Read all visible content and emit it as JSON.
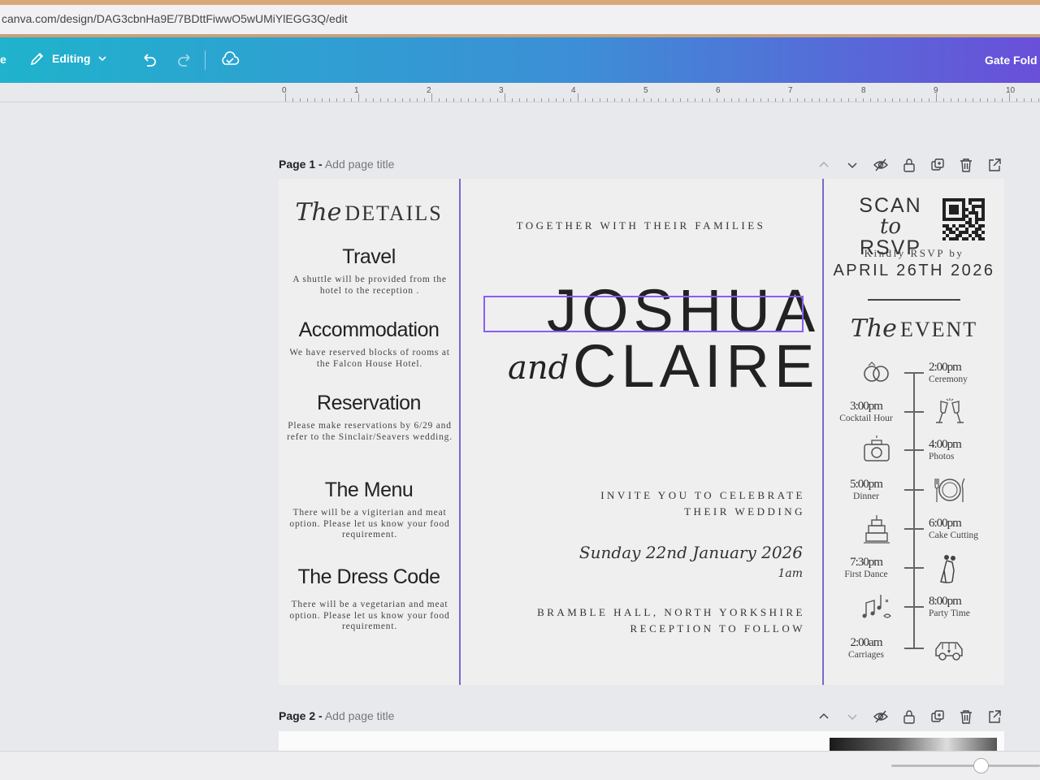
{
  "browser": {
    "url": "canva.com/design/DAG3cbnHa9E/7BDttFiwwO5wUMiYlEGG3Q/edit"
  },
  "toolbar": {
    "left_partial": "e",
    "editing_label": "Editing",
    "doc_title": "Gate Fold",
    "icons": [
      "pencil-icon",
      "chevron-down-icon",
      "undo-icon",
      "redo-icon",
      "cloud-sync-icon"
    ]
  },
  "ruler": {
    "ticks": [
      "0",
      "1",
      "2",
      "3",
      "4",
      "5",
      "6",
      "7",
      "8",
      "9",
      "10"
    ]
  },
  "page1": {
    "label": "Page 1 -",
    "title_placeholder": "Add page title"
  },
  "page2": {
    "label": "Page 2 -",
    "title_placeholder": "Add page title"
  },
  "details": {
    "title_script": "The",
    "title": "DETAILS",
    "sections": [
      {
        "heading": "Travel",
        "body": "A shuttle will be provided from the hotel to the reception ."
      },
      {
        "heading": "Accommodation",
        "body": "We have reserved blocks of rooms at the Falcon House Hotel."
      },
      {
        "heading": "Reservation",
        "body": "Please make reservations by 6/29 and refer to the Sinclair/Seavers wedding."
      },
      {
        "heading": "The Menu",
        "body": "There will be a vigiterian and meat option.  Please let us know your food requirement."
      },
      {
        "heading": "The Dress Code",
        "body": "There will be a vegetarian and meat option.  Please let us know your food requirement."
      }
    ]
  },
  "invite": {
    "together": "TOGETHER WITH THEIR FAMILIES",
    "name1": "JOSHUA",
    "and": "and",
    "name2": "CLAIRE",
    "invite_line1": "INVITE YOU TO CELEBRATE",
    "invite_line2": "THEIR WEDDING",
    "date": "Sunday 22nd January 2026",
    "time": "1am",
    "venue_line1": "BRAMBLE HALL, NORTH YORKSHIRE",
    "venue_line2": "RECEPTION TO FOLLOW"
  },
  "rsvp": {
    "scan": "SCAN",
    "to": "to",
    "rsvp": "RSVP",
    "kindly": "Kindly RSVP by",
    "date": "APRIL 26TH 2026"
  },
  "event": {
    "title_script": "The",
    "title": "EVENT",
    "items": [
      {
        "time": "2:00pm",
        "label": "Ceremony",
        "icon": "rings-icon"
      },
      {
        "time": "3:00pm",
        "label": "Cocktail Hour",
        "icon": "champagne-glasses-icon"
      },
      {
        "time": "4:00pm",
        "label": "Photos",
        "icon": "camera-icon"
      },
      {
        "time": "5:00pm",
        "label": "Dinner",
        "icon": "plate-cutlery-icon"
      },
      {
        "time": "6:00pm",
        "label": "Cake Cutting",
        "icon": "cake-icon"
      },
      {
        "time": "7:30pm",
        "label": "First Dance",
        "icon": "dancing-couple-icon"
      },
      {
        "time": "8:00pm",
        "label": "Party Time",
        "icon": "music-notes-icon"
      },
      {
        "time": "2:00am",
        "label": "Carriages",
        "icon": "car-icon"
      }
    ]
  }
}
